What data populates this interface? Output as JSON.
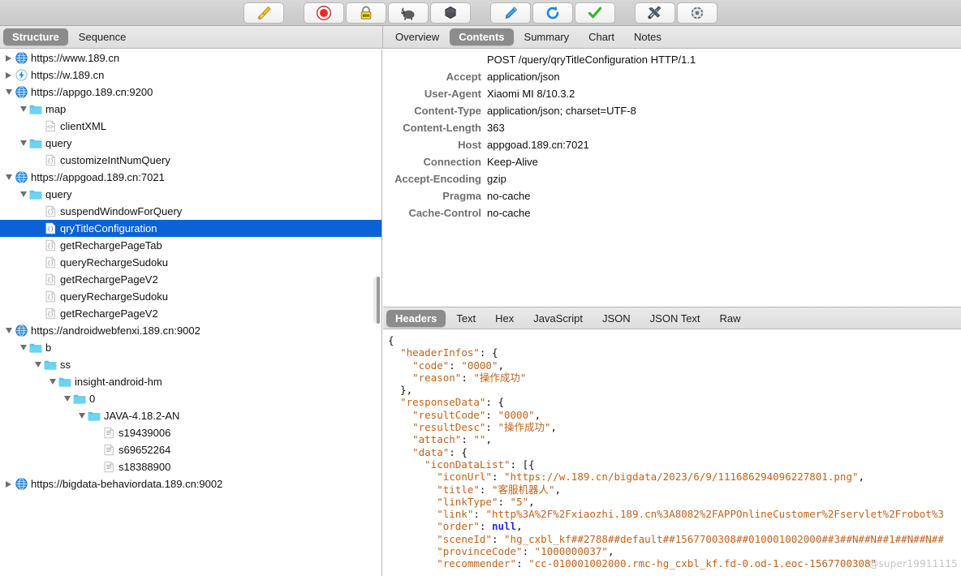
{
  "toolbar": {
    "buttons": [
      {
        "name": "clear-icon",
        "title": "Clear"
      },
      {
        "name": "record-icon",
        "title": "Start/Stop Recording"
      },
      {
        "name": "ssl-lock-icon",
        "title": "SSL Proxying"
      },
      {
        "name": "throttle-turtle-icon",
        "title": "Throttle Settings"
      },
      {
        "name": "breakpoints-icon",
        "title": "Breakpoints"
      },
      {
        "name": "compose-pen-icon",
        "title": "Compose"
      },
      {
        "name": "repeat-refresh-icon",
        "title": "Repeat"
      },
      {
        "name": "validate-check-icon",
        "title": "Validate"
      },
      {
        "name": "tools-icon",
        "title": "Tools"
      },
      {
        "name": "settings-gear-icon",
        "title": "Settings"
      }
    ]
  },
  "left_tabs": {
    "items": [
      "Structure",
      "Sequence"
    ],
    "active": "Structure"
  },
  "right_tabs": {
    "items": [
      "Overview",
      "Contents",
      "Summary",
      "Chart",
      "Notes"
    ],
    "active": "Contents"
  },
  "body_tabs": {
    "items": [
      "Headers",
      "Text",
      "Hex",
      "JavaScript",
      "JSON",
      "JSON Text",
      "Raw"
    ],
    "active": "Headers"
  },
  "tree": {
    "rows": [
      {
        "label": "https://www.189.cn",
        "indent": 0,
        "twisty": "closed",
        "icon": "globe-icon",
        "selected": false
      },
      {
        "label": "https://w.189.cn",
        "indent": 0,
        "twisty": "closed",
        "icon": "bolt-icon",
        "selected": false
      },
      {
        "label": "https://appgo.189.cn:9200",
        "indent": 0,
        "twisty": "open",
        "icon": "globe-icon",
        "selected": false
      },
      {
        "label": "map",
        "indent": 1,
        "twisty": "open",
        "icon": "folder-icon",
        "selected": false
      },
      {
        "label": "clientXML",
        "indent": 2,
        "twisty": "none",
        "icon": "xml-doc-icon",
        "selected": false
      },
      {
        "label": "query",
        "indent": 1,
        "twisty": "open",
        "icon": "folder-icon",
        "selected": false
      },
      {
        "label": "customizeIntNumQuery",
        "indent": 2,
        "twisty": "none",
        "icon": "json-doc-icon",
        "selected": false
      },
      {
        "label": "https://appgoad.189.cn:7021",
        "indent": 0,
        "twisty": "open",
        "icon": "globe-icon",
        "selected": false
      },
      {
        "label": "query",
        "indent": 1,
        "twisty": "open",
        "icon": "folder-icon",
        "selected": false
      },
      {
        "label": "suspendWindowForQuery",
        "indent": 2,
        "twisty": "none",
        "icon": "json-doc-icon",
        "selected": false
      },
      {
        "label": "qryTitleConfiguration",
        "indent": 2,
        "twisty": "none",
        "icon": "json-doc-icon",
        "selected": true
      },
      {
        "label": "getRechargePageTab",
        "indent": 2,
        "twisty": "none",
        "icon": "json-doc-icon",
        "selected": false
      },
      {
        "label": "queryRechargeSudoku",
        "indent": 2,
        "twisty": "none",
        "icon": "json-doc-icon",
        "selected": false
      },
      {
        "label": "getRechargePageV2",
        "indent": 2,
        "twisty": "none",
        "icon": "json-doc-icon",
        "selected": false
      },
      {
        "label": "queryRechargeSudoku",
        "indent": 2,
        "twisty": "none",
        "icon": "json-doc-icon",
        "selected": false
      },
      {
        "label": "getRechargePageV2",
        "indent": 2,
        "twisty": "none",
        "icon": "json-doc-icon",
        "selected": false
      },
      {
        "label": "https://androidwebfenxi.189.cn:9002",
        "indent": 0,
        "twisty": "open",
        "icon": "globe-icon",
        "selected": false
      },
      {
        "label": "b",
        "indent": 1,
        "twisty": "open",
        "icon": "folder-icon",
        "selected": false
      },
      {
        "label": "ss",
        "indent": 2,
        "twisty": "open",
        "icon": "folder-icon",
        "selected": false
      },
      {
        "label": "insight-android-hm",
        "indent": 3,
        "twisty": "open",
        "icon": "folder-icon",
        "selected": false
      },
      {
        "label": "0",
        "indent": 4,
        "twisty": "open",
        "icon": "folder-icon",
        "selected": false
      },
      {
        "label": "JAVA-4.18.2-AN",
        "indent": 5,
        "twisty": "open",
        "icon": "folder-icon",
        "selected": false
      },
      {
        "label": "s19439006",
        "indent": 6,
        "twisty": "none",
        "icon": "plain-doc-icon",
        "selected": false
      },
      {
        "label": "s69652264",
        "indent": 6,
        "twisty": "none",
        "icon": "plain-doc-icon",
        "selected": false
      },
      {
        "label": "s18388900",
        "indent": 6,
        "twisty": "none",
        "icon": "plain-doc-icon",
        "selected": false
      },
      {
        "label": "https://bigdata-behaviordata.189.cn:9002",
        "indent": 0,
        "twisty": "closed",
        "icon": "globe-icon",
        "selected": false
      }
    ]
  },
  "headers": {
    "request_line": "POST /query/qryTitleConfiguration HTTP/1.1",
    "rows": [
      {
        "key": "Accept",
        "value": "application/json"
      },
      {
        "key": "User-Agent",
        "value": "Xiaomi MI 8/10.3.2"
      },
      {
        "key": "Content-Type",
        "value": "application/json; charset=UTF-8"
      },
      {
        "key": "Content-Length",
        "value": "363"
      },
      {
        "key": "Host",
        "value": "appgoad.189.cn:7021"
      },
      {
        "key": "Connection",
        "value": "Keep-Alive"
      },
      {
        "key": "Accept-Encoding",
        "value": "gzip"
      },
      {
        "key": "Pragma",
        "value": "no-cache"
      },
      {
        "key": "Cache-Control",
        "value": "no-cache"
      }
    ]
  },
  "json_body": {
    "lines": [
      [
        {
          "t": "{",
          "c": "pun"
        }
      ],
      [
        {
          "t": "  ",
          "c": "pun"
        },
        {
          "t": "\"headerInfos\"",
          "c": "str"
        },
        {
          "t": ": {",
          "c": "pun"
        }
      ],
      [
        {
          "t": "    ",
          "c": "pun"
        },
        {
          "t": "\"code\"",
          "c": "str"
        },
        {
          "t": ": ",
          "c": "pun"
        },
        {
          "t": "\"0000\"",
          "c": "str"
        },
        {
          "t": ",",
          "c": "pun"
        }
      ],
      [
        {
          "t": "    ",
          "c": "pun"
        },
        {
          "t": "\"reason\"",
          "c": "str"
        },
        {
          "t": ": ",
          "c": "pun"
        },
        {
          "t": "\"操作成功\"",
          "c": "str"
        }
      ],
      [
        {
          "t": "  },",
          "c": "pun"
        }
      ],
      [
        {
          "t": "  ",
          "c": "pun"
        },
        {
          "t": "\"responseData\"",
          "c": "str"
        },
        {
          "t": ": {",
          "c": "pun"
        }
      ],
      [
        {
          "t": "    ",
          "c": "pun"
        },
        {
          "t": "\"resultCode\"",
          "c": "str"
        },
        {
          "t": ": ",
          "c": "pun"
        },
        {
          "t": "\"0000\"",
          "c": "str"
        },
        {
          "t": ",",
          "c": "pun"
        }
      ],
      [
        {
          "t": "    ",
          "c": "pun"
        },
        {
          "t": "\"resultDesc\"",
          "c": "str"
        },
        {
          "t": ": ",
          "c": "pun"
        },
        {
          "t": "\"操作成功\"",
          "c": "str"
        },
        {
          "t": ",",
          "c": "pun"
        }
      ],
      [
        {
          "t": "    ",
          "c": "pun"
        },
        {
          "t": "\"attach\"",
          "c": "str"
        },
        {
          "t": ": ",
          "c": "pun"
        },
        {
          "t": "\"\"",
          "c": "str"
        },
        {
          "t": ",",
          "c": "pun"
        }
      ],
      [
        {
          "t": "    ",
          "c": "pun"
        },
        {
          "t": "\"data\"",
          "c": "str"
        },
        {
          "t": ": {",
          "c": "pun"
        }
      ],
      [
        {
          "t": "      ",
          "c": "pun"
        },
        {
          "t": "\"iconDataList\"",
          "c": "str"
        },
        {
          "t": ": [{",
          "c": "pun"
        }
      ],
      [
        {
          "t": "        ",
          "c": "pun"
        },
        {
          "t": "\"iconUrl\"",
          "c": "str"
        },
        {
          "t": ": ",
          "c": "pun"
        },
        {
          "t": "\"https://w.189.cn/bigdata/2023/6/9/111686294096227801.png\"",
          "c": "str"
        },
        {
          "t": ",",
          "c": "pun"
        }
      ],
      [
        {
          "t": "        ",
          "c": "pun"
        },
        {
          "t": "\"title\"",
          "c": "str"
        },
        {
          "t": ": ",
          "c": "pun"
        },
        {
          "t": "\"客服机器人\"",
          "c": "str"
        },
        {
          "t": ",",
          "c": "pun"
        }
      ],
      [
        {
          "t": "        ",
          "c": "pun"
        },
        {
          "t": "\"linkType\"",
          "c": "str"
        },
        {
          "t": ": ",
          "c": "pun"
        },
        {
          "t": "\"5\"",
          "c": "str"
        },
        {
          "t": ",",
          "c": "pun"
        }
      ],
      [
        {
          "t": "        ",
          "c": "pun"
        },
        {
          "t": "\"link\"",
          "c": "str"
        },
        {
          "t": ": ",
          "c": "pun"
        },
        {
          "t": "\"http%3A%2F%2Fxiaozhi.189.cn%3A8082%2FAPPOnlineCustomer%2Fservlet%2Frobot%3",
          "c": "str"
        }
      ],
      [
        {
          "t": "        ",
          "c": "pun"
        },
        {
          "t": "\"order\"",
          "c": "str"
        },
        {
          "t": ": ",
          "c": "pun"
        },
        {
          "t": "null",
          "c": "null"
        },
        {
          "t": ",",
          "c": "pun"
        }
      ],
      [
        {
          "t": "        ",
          "c": "pun"
        },
        {
          "t": "\"sceneId\"",
          "c": "str"
        },
        {
          "t": ": ",
          "c": "pun"
        },
        {
          "t": "\"hg_cxbl_kf##2788##default##1567700308##010001002000##3##N##N##1##N##N##",
          "c": "str"
        }
      ],
      [
        {
          "t": "        ",
          "c": "pun"
        },
        {
          "t": "\"provinceCode\"",
          "c": "str"
        },
        {
          "t": ": ",
          "c": "pun"
        },
        {
          "t": "\"1000000037\"",
          "c": "str"
        },
        {
          "t": ",",
          "c": "pun"
        }
      ],
      [
        {
          "t": "        ",
          "c": "pun"
        },
        {
          "t": "\"recommender\"",
          "c": "str"
        },
        {
          "t": ": ",
          "c": "pun"
        },
        {
          "t": "\"cc-010001002000.rmc-hg_cxbl_kf.fd-0.od-1.eoc-1567700308\"",
          "c": "str"
        }
      ]
    ]
  },
  "watermark": "@super19911115",
  "colors": {
    "selection_blue": "#0b62d6",
    "json_string": "#c2621a",
    "json_null": "#2a2adf",
    "tab_active_bg": "#8c8c8c",
    "folder_cyan": "#5ac8ec"
  }
}
